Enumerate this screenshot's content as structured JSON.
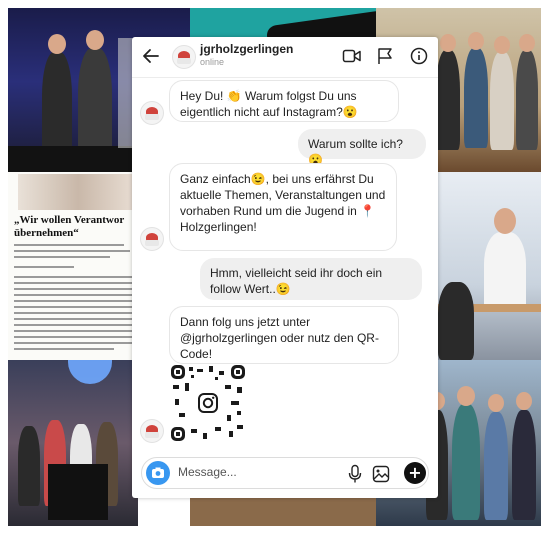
{
  "chat": {
    "username": "jgrholzgerlingen",
    "status": "online",
    "messages": [
      {
        "from": "them",
        "text": "Hey Du! 👏 Warum folgst Du uns eigentlich nicht auf Instagram?😮"
      },
      {
        "from": "me",
        "text": "Warum sollte ich? 😮"
      },
      {
        "from": "them",
        "text": "Ganz einfach😉, bei uns erfährst Du aktuelle Themen, Veranstaltungen und vorhaben Rund um die Jugend in 📍 Holzgerlingen!"
      },
      {
        "from": "me",
        "text": "Hmm, vielleicht seid ihr doch ein follow Wert..😉"
      },
      {
        "from": "them",
        "text": "Dann folg uns jetzt unter @jgrholzgerlingen oder nutz den QR-Code!"
      }
    ],
    "composer_placeholder": "Message..."
  },
  "newspaper": {
    "headline": "„Wir wollen Verantwor übernehmen“"
  },
  "icons": [
    "back-arrow-icon",
    "video-call-icon",
    "flag-icon",
    "info-icon",
    "camera-icon",
    "microphone-icon",
    "gallery-icon",
    "plus-icon",
    "instagram-logo-icon"
  ],
  "colors": {
    "accent": "#3897f0",
    "outgoing_bubble": "#efefef",
    "incoming_border": "#e6e6e6"
  }
}
